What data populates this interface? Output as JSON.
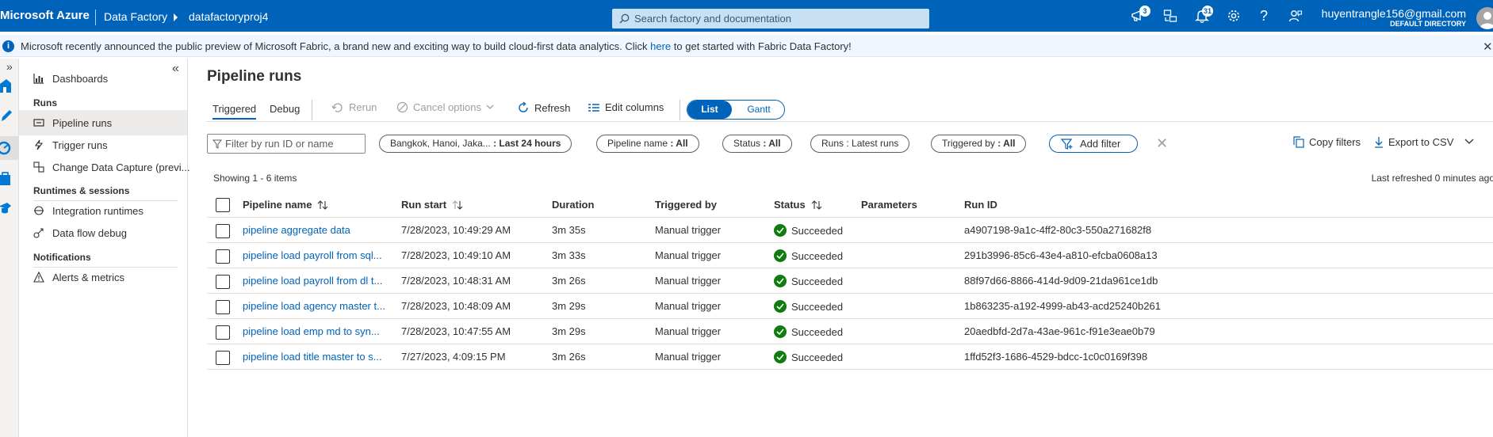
{
  "topbar": {
    "brand": "Microsoft Azure",
    "crumb_service": "Data Factory",
    "crumb_factory": "datafactoryproj4",
    "search_placeholder": "Search factory and documentation",
    "notifications_count": "3",
    "alerts_count": "31",
    "user_email": "huyentrangle156@gmail.com",
    "user_directory": "DEFAULT DIRECTORY",
    "bar_color": "#0063ba"
  },
  "banner": {
    "text_before": "Microsoft recently announced the public preview of Microsoft Fabric, a brand new and exciting way to build cloud-first data analytics. Click",
    "link": "here",
    "text_after": "to get started with Fabric Data Factory!"
  },
  "sidebar": {
    "dashboards": "Dashboards",
    "runs_section": "Runs",
    "pipeline_runs": "Pipeline runs",
    "trigger_runs": "Trigger runs",
    "change_data_capture": "Change Data Capture (previ...",
    "runtimes_section": "Runtimes & sessions",
    "integration_runtimes": "Integration runtimes",
    "data_flow_debug": "Data flow debug",
    "notifications_section": "Notifications",
    "alerts_metrics": "Alerts & metrics"
  },
  "main": {
    "title": "Pipeline runs",
    "tabs": [
      "Triggered",
      "Debug"
    ],
    "toolbar": {
      "rerun": "Rerun",
      "cancel": "Cancel options",
      "refresh": "Refresh",
      "edit_columns": "Edit columns",
      "view_list": "List",
      "view_gantt": "Gantt"
    },
    "filters": {
      "search_placeholder": "Filter by run ID or name",
      "timezone_label": "Bangkok, Hanoi, Jaka...",
      "timezone_value": ": Last 24 hours",
      "pipeline_name_label": "Pipeline name",
      "pipeline_name_value": ": All",
      "status_label": "Status",
      "status_value": ": All",
      "runs_label": "Runs",
      "runs_value": ": Latest runs",
      "triggered_by_label": "Triggered by",
      "triggered_by_value": ": All",
      "add_filter": "Add filter",
      "copy_filters": "Copy filters",
      "export_csv": "Export to CSV"
    },
    "showing": "Showing 1 - 6 items",
    "last_refreshed": "Last refreshed 0 minutes ago",
    "columns": [
      "Pipeline name",
      "Run start",
      "Duration",
      "Triggered by",
      "Status",
      "Parameters",
      "Run ID"
    ],
    "rows": [
      {
        "name": "pipeline aggregate data",
        "start": "7/28/2023, 10:49:29 AM",
        "duration": "3m 35s",
        "trigger": "Manual trigger",
        "status": "Succeeded",
        "params": "",
        "run_id": "a4907198-9a1c-4ff2-80c3-550a271682f8"
      },
      {
        "name": "pipeline load payroll from sql...",
        "start": "7/28/2023, 10:49:10 AM",
        "duration": "3m 33s",
        "trigger": "Manual trigger",
        "status": "Succeeded",
        "params": "",
        "run_id": "291b3996-85c6-43e4-a810-efcba0608a13"
      },
      {
        "name": "pipeline load payroll from dl t...",
        "start": "7/28/2023, 10:48:31 AM",
        "duration": "3m 26s",
        "trigger": "Manual trigger",
        "status": "Succeeded",
        "params": "",
        "run_id": "88f97d66-8866-414d-9d09-21da961ce1db"
      },
      {
        "name": "pipeline load agency master t...",
        "start": "7/28/2023, 10:48:09 AM",
        "duration": "3m 29s",
        "trigger": "Manual trigger",
        "status": "Succeeded",
        "params": "",
        "run_id": "1b863235-a192-4999-ab43-acd25240b261"
      },
      {
        "name": "pipeline load emp md to syn...",
        "start": "7/28/2023, 10:47:55 AM",
        "duration": "3m 29s",
        "trigger": "Manual trigger",
        "status": "Succeeded",
        "params": "",
        "run_id": "20aedbfd-2d7a-43ae-961c-f91e3eae0b79"
      },
      {
        "name": "pipeline load title master to s...",
        "start": "7/27/2023, 4:09:15 PM",
        "duration": "3m 26s",
        "trigger": "Manual trigger",
        "status": "Succeeded",
        "params": "",
        "run_id": "1ffd52f3-1686-4529-bdcc-1c0c0169f398"
      }
    ]
  }
}
